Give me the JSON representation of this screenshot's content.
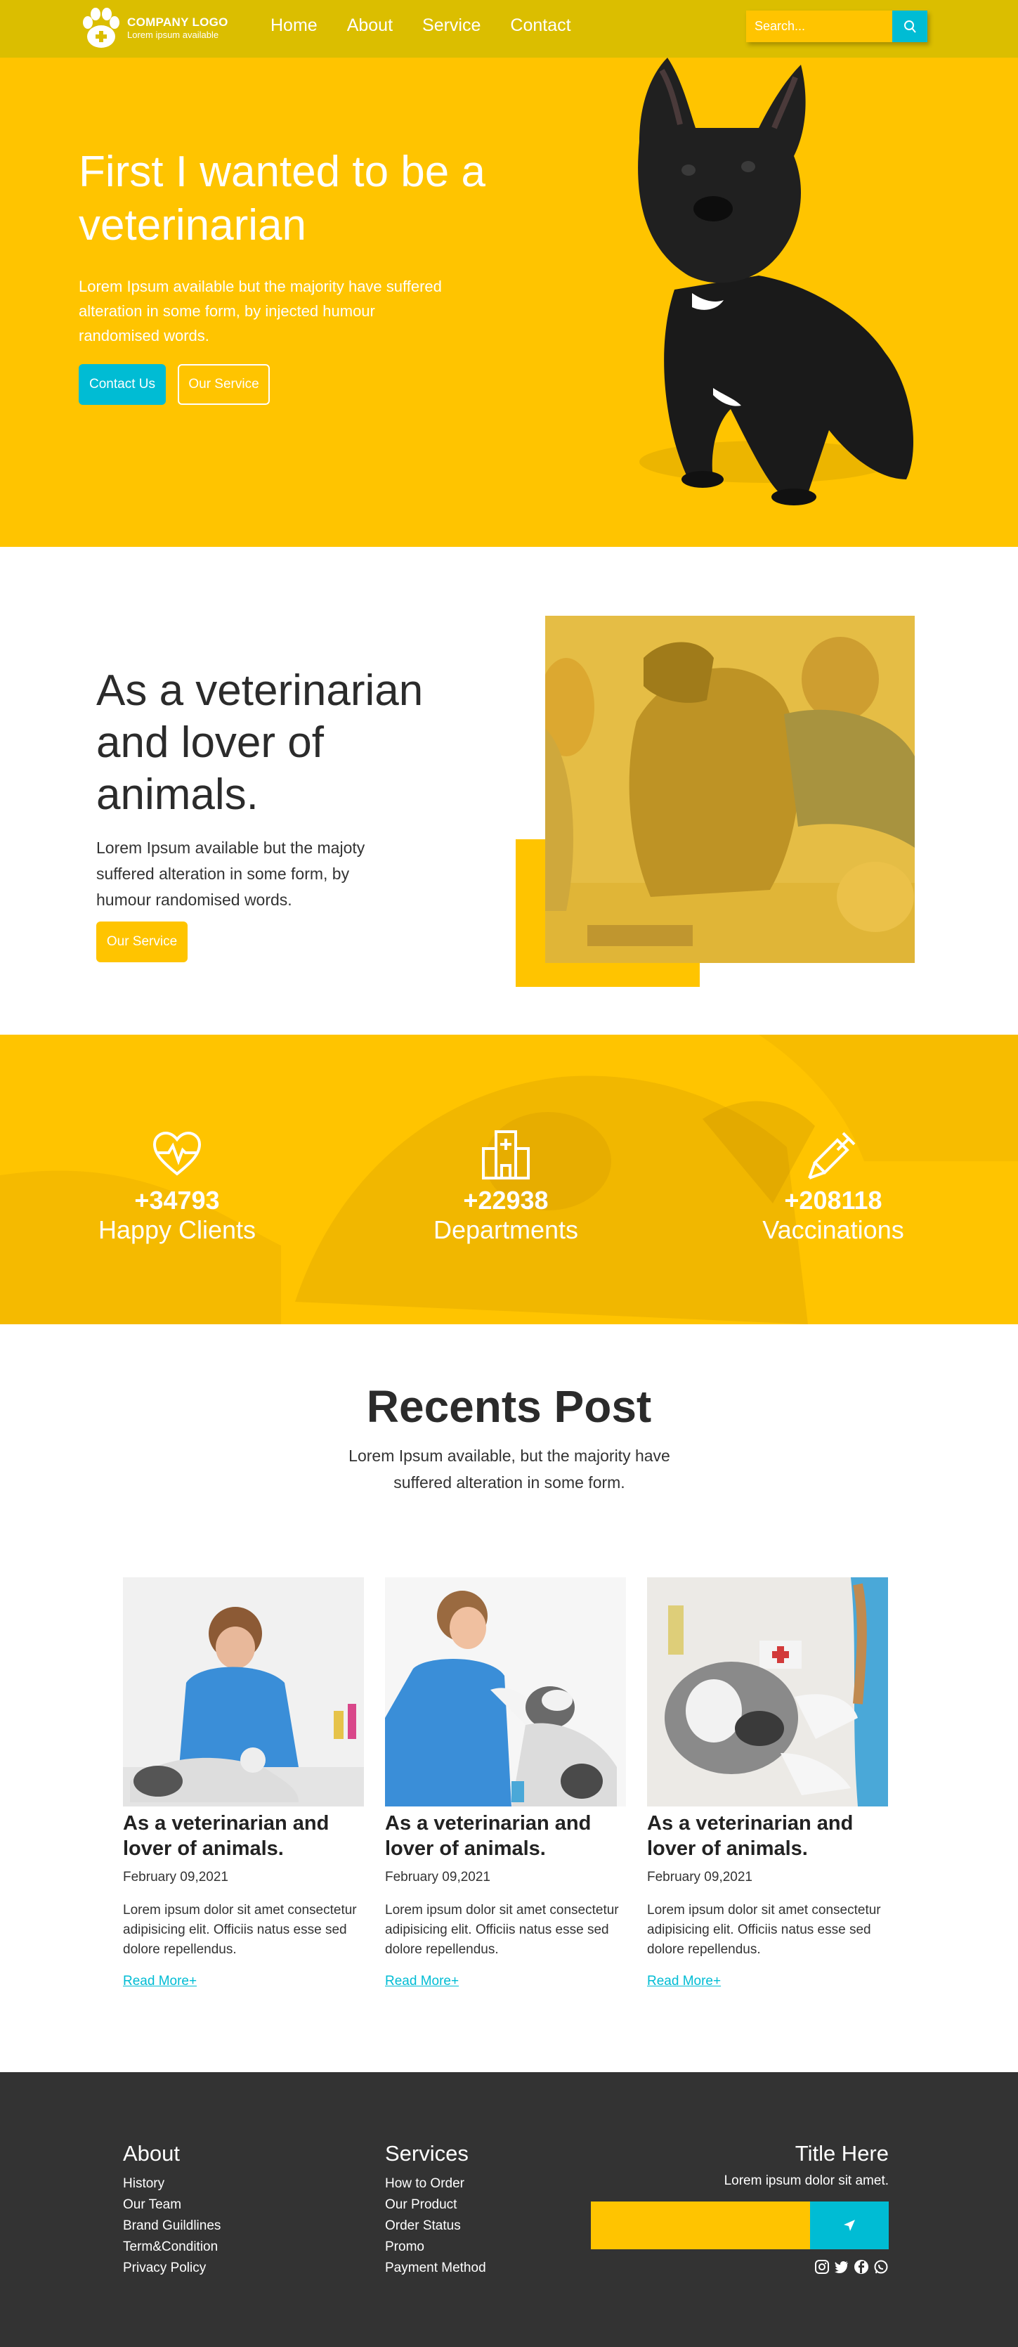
{
  "colors": {
    "header_bg": "#DBBE00",
    "primary_yellow": "#FFC400",
    "accent_cyan": "#00BCD4",
    "footer_bg": "#333333"
  },
  "nav": {
    "logo_title": "COMPANY LOGO",
    "logo_subtitle": "Lorem ipsum available",
    "links": [
      "Home",
      "About",
      "Service",
      "Contact"
    ],
    "search_placeholder": "Search..."
  },
  "hero": {
    "title": "First I wanted to be a veterinarian",
    "text": "Lorem Ipsum available but the majority have suffered alteration in some form, by injected humour randomised words.",
    "primary_button": "Contact Us",
    "secondary_button": "Our Service"
  },
  "about": {
    "title": "As a veterinarian and lover of animals.",
    "text": "Lorem Ipsum available but the majoty suffered alteration in some form, by humour randomised words.",
    "button": "Our Service"
  },
  "stats": [
    {
      "icon": "heartbeat-icon",
      "value": "+34793",
      "label": "Happy Clients"
    },
    {
      "icon": "hospital-icon",
      "value": "+22938",
      "label": "Departments"
    },
    {
      "icon": "syringe-icon",
      "value": "+208118",
      "label": "Vaccinations"
    }
  ],
  "posts": {
    "title": "Recents Post",
    "subtitle": "Lorem Ipsum available, but the majority have suffered alteration in some form.",
    "items": [
      {
        "title": "As a veterinarian and lover of animals.",
        "date": "February 09,2021",
        "text": "Lorem ipsum dolor sit amet consectetur adipisicing elit. Officiis natus esse sed dolore repellendus.",
        "link": "Read More+"
      },
      {
        "title": "As a veterinarian and lover of animals.",
        "date": "February 09,2021",
        "text": "Lorem ipsum dolor sit amet consectetur adipisicing elit. Officiis natus esse sed dolore repellendus.",
        "link": "Read More+"
      },
      {
        "title": "As a veterinarian and lover of animals.",
        "date": "February 09,2021",
        "text": "Lorem ipsum dolor sit amet consectetur adipisicing elit. Officiis natus esse sed dolore repellendus.",
        "link": "Read More+"
      }
    ]
  },
  "footer": {
    "about": {
      "title": "About",
      "links": [
        "History",
        "Our Team",
        "Brand Guildlines",
        "Term&Condition",
        "Privacy Policy"
      ]
    },
    "services": {
      "title": "Services",
      "links": [
        "How to Order",
        "Our Product",
        "Order Status",
        "Promo",
        "Payment Method"
      ]
    },
    "newsletter": {
      "title": "Title Here",
      "text": "Lorem ipsum dolor sit amet."
    },
    "socials": [
      "instagram-icon",
      "twitter-icon",
      "facebook-icon",
      "whatsapp-icon"
    ]
  }
}
